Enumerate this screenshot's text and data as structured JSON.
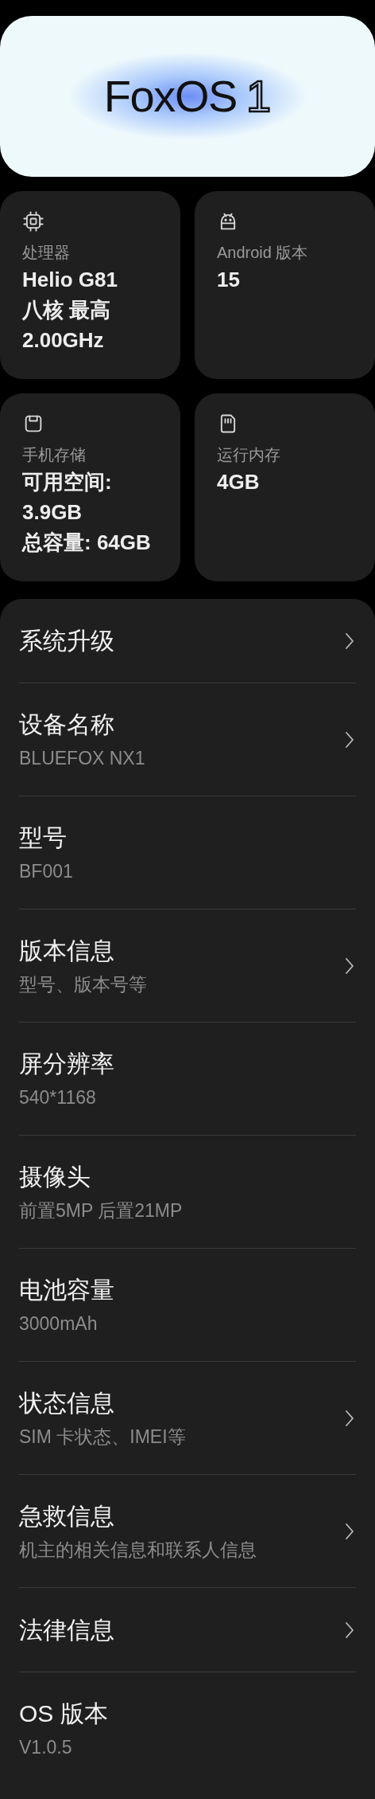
{
  "banner": {
    "logo_text": "FoxOS",
    "logo_number": "1"
  },
  "cards": [
    {
      "kind": "chip",
      "label": "处理器",
      "value_lines": [
        "Helio G81",
        "八核 最高",
        "2.00GHz"
      ]
    },
    {
      "kind": "android",
      "label": "Android 版本",
      "value_lines": [
        "15"
      ]
    },
    {
      "kind": "storage",
      "label": "手机存储",
      "value_lines": [
        "可用空间:",
        "3.9GB",
        "总容量: 64GB"
      ]
    },
    {
      "kind": "memory",
      "label": "运行内存",
      "value_lines": [
        "4GB"
      ]
    }
  ],
  "list": [
    {
      "title": "系统升级",
      "chevron": true
    },
    {
      "title": "设备名称",
      "subtitle": "BLUEFOX NX1",
      "chevron": true
    },
    {
      "title": "型号",
      "subtitle": "BF001",
      "chevron": false
    },
    {
      "title": "版本信息",
      "subtitle": "型号、版本号等",
      "chevron": true
    },
    {
      "title": "屏分辨率",
      "subtitle": "540*1168",
      "chevron": false
    },
    {
      "title": "摄像头",
      "subtitle": "前置5MP 后置21MP",
      "chevron": false
    },
    {
      "title": "电池容量",
      "subtitle": "3000mAh",
      "chevron": false
    },
    {
      "title": "状态信息",
      "subtitle": "SIM 卡状态、IMEI等",
      "chevron": true
    },
    {
      "title": "急救信息",
      "subtitle": "机主的相关信息和联系人信息",
      "chevron": true
    },
    {
      "title": "法律信息",
      "chevron": true
    },
    {
      "title": "OS 版本",
      "subtitle": "V1.0.5",
      "chevron": false
    }
  ]
}
